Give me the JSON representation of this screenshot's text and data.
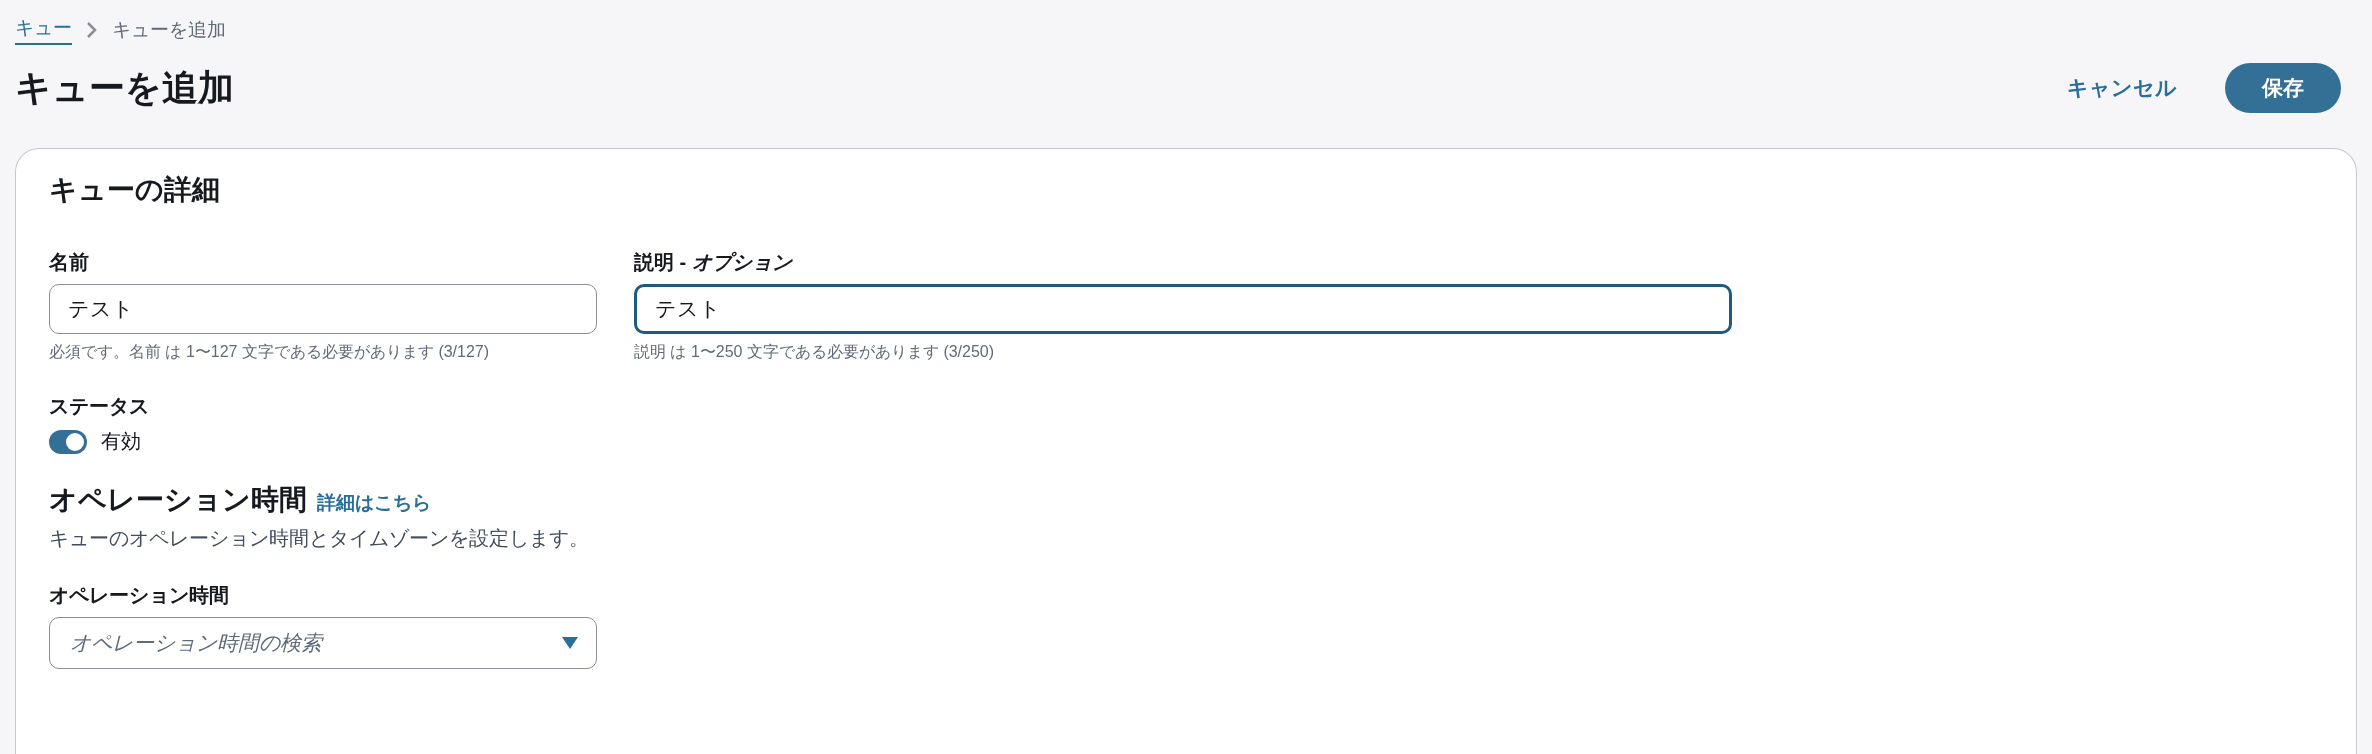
{
  "breadcrumb": [
    {
      "label": "キュー",
      "kind": "link"
    },
    {
      "label": "キューを追加",
      "kind": "current"
    }
  ],
  "page_title": "キューを追加",
  "actions": [
    {
      "label": "キャンセル",
      "kind": "link"
    },
    {
      "label": "保存",
      "kind": "primary"
    }
  ],
  "card": {
    "title": "キューの詳細",
    "fields": [
      {
        "label": "名前",
        "value": "テスト",
        "focused": false,
        "hint": "必須です。名前 は 1〜127 文字である必要があります (3/127)"
      },
      {
        "label": "説明 - *オプション*",
        "value": "テスト",
        "focused": true,
        "hint": "説明 は 1〜250 文字である必要があります (3/250)"
      }
    ],
    "status": {
      "label": "ステータス",
      "toggle_label": "有効",
      "on": true
    },
    "hours": {
      "heading": "オペレーション時間",
      "link": "詳細はこちら",
      "description": "キューのオペレーション時間とタイムゾーンを設定します。",
      "select_label": "オペレーション時間",
      "placeholder": "オペレーション時間の検索"
    }
  }
}
